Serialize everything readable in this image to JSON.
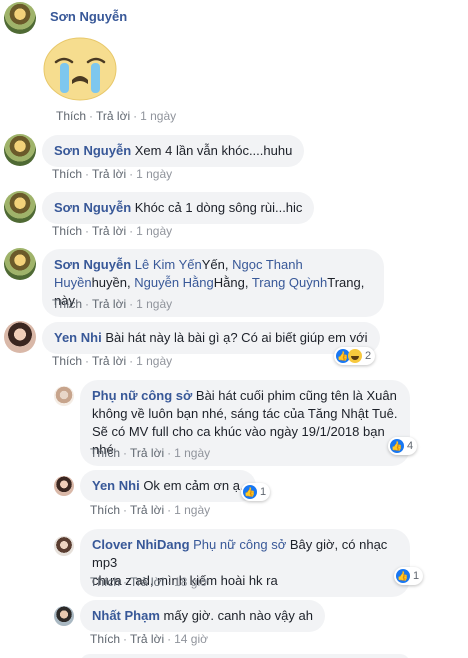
{
  "actions": {
    "like": "Thích",
    "reply": "Trả lời",
    "dot": "·"
  },
  "comments": [
    {
      "author": "Sơn Nguyễn",
      "sticker": "crying-face",
      "time": "1 ngày"
    },
    {
      "author": "Sơn Nguyễn",
      "text": "Xem 4 lần vẫn khóc....huhu",
      "time": "1 ngày"
    },
    {
      "author": "Sơn Nguyễn",
      "text": "Khóc cả 1 dòng sông rùi...hic",
      "time": "1 ngày"
    },
    {
      "author": "Sơn Nguyễn",
      "tags": [
        "Lê Kim Yến",
        "Ngọc Thanh Huyền",
        "Nguyễn Hằng",
        "Trang Quỳnh"
      ],
      "suffixes": [
        "Yến,",
        "huyền,",
        "Hằng,",
        "Trang, này"
      ],
      "time": "1 ngày"
    },
    {
      "author": "Yen Nhi",
      "text": "Bài hát này là bài gì ạ? Có ai biết giúp em với",
      "time": "1 ngày",
      "reactions": "2"
    },
    {
      "author": "Phụ nữ công sở",
      "lines": [
        "Bài hát cuối phim cũng tên là Xuân",
        "không về luôn bạn nhé, sáng tác của Tăng Nhật Tuê.",
        "Sẽ có MV full cho ca khúc vào ngày 19/1/2018 bạn nhé"
      ],
      "time": "1 ngày",
      "reactions": "4"
    },
    {
      "author": "Yen Nhi",
      "text": "Ok em cảm ơn ạ.",
      "time": "1 ngày",
      "reactions": "1"
    },
    {
      "author": "Clover NhiDang",
      "tag": "Phụ nữ công sở",
      "lines": [
        "Bây giờ, có nhạc mp3",
        "chưa z ad, mình kiếm hoài hk ra"
      ],
      "time": "18 giờ",
      "reactions": "1"
    },
    {
      "author": "Nhất Phạm",
      "text": "mấy giờ. canh nào vậy ah",
      "time": "14 giờ"
    }
  ],
  "colors": {
    "link": "#385898",
    "bubble": "#f2f3f5",
    "like_blue": "#1877f2"
  }
}
